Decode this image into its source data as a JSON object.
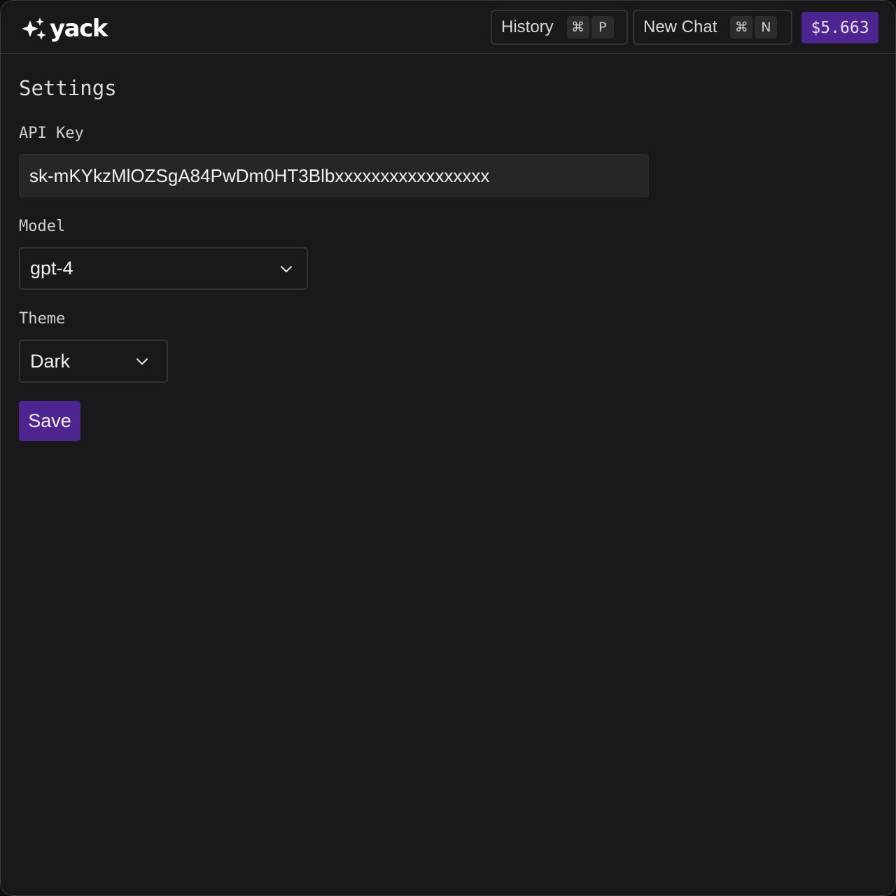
{
  "app": {
    "name": "yack",
    "accent_color": "#4c2590"
  },
  "header": {
    "history": {
      "label": "History",
      "shortcut_modifier": "⌘",
      "shortcut_key": "P"
    },
    "new_chat": {
      "label": "New Chat",
      "shortcut_modifier": "⌘",
      "shortcut_key": "N"
    },
    "cost": "$5.663"
  },
  "settings": {
    "title": "Settings",
    "api_key": {
      "label": "API Key",
      "value": "sk-mKYkzMlOZSgA84PwDm0HT3Blbxxxxxxxxxxxxxxxxx"
    },
    "model": {
      "label": "Model",
      "selected": "gpt-4"
    },
    "theme": {
      "label": "Theme",
      "selected": "Dark"
    },
    "save_label": "Save"
  },
  "icons": {
    "logo": "sparkles-icon",
    "dropdown": "chevron-down-icon"
  }
}
